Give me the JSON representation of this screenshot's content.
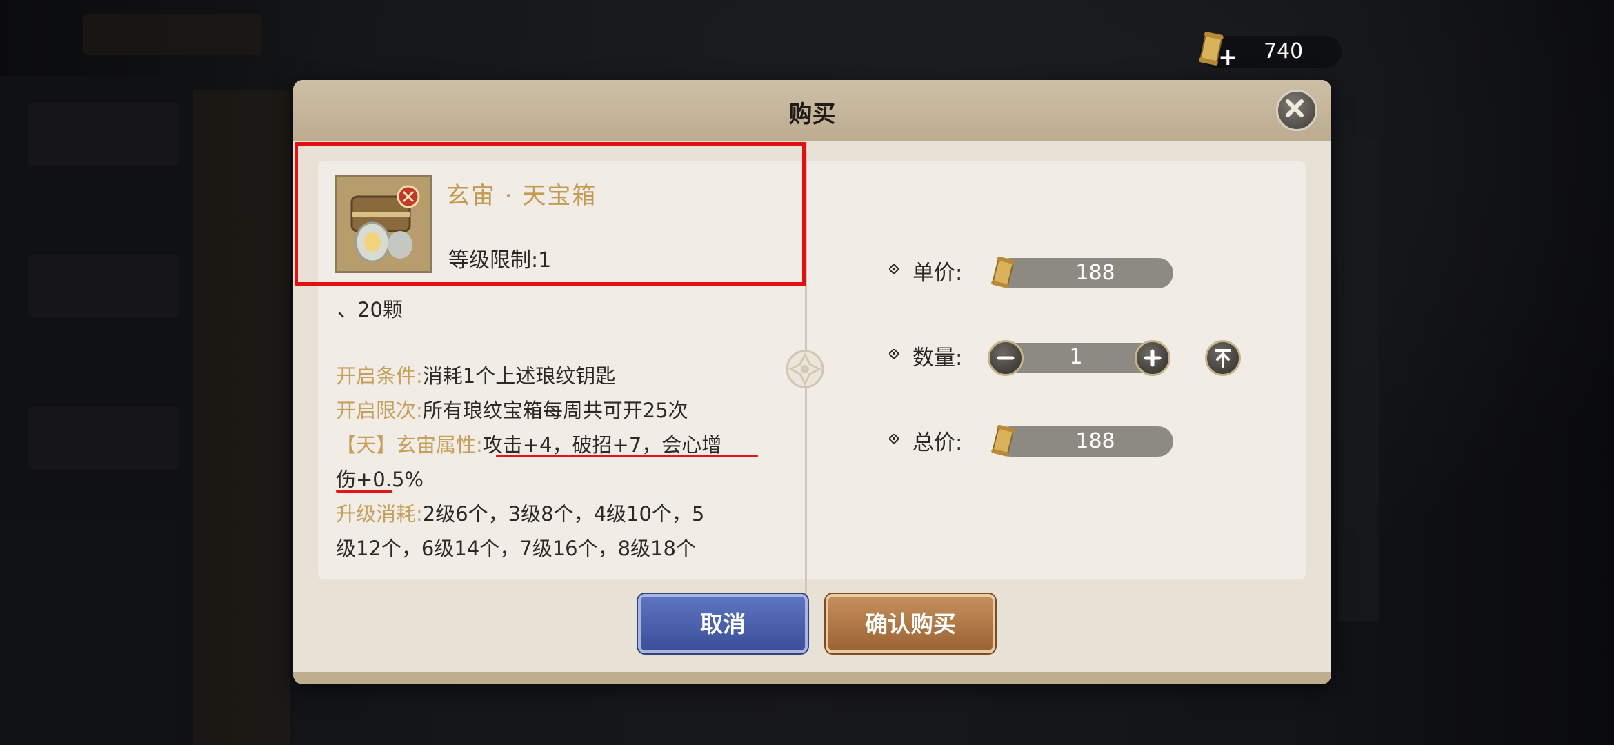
{
  "currency": {
    "value": "740",
    "plus": "+",
    "icon": "scroll-currency-icon"
  },
  "dialog": {
    "title": "购买",
    "close_icon": "close-icon",
    "item": {
      "name": "玄宙 · 天宝箱",
      "level_limit": "等级限制:1",
      "icon": "treasure-chest-icon"
    },
    "description": {
      "line0": "、20颗",
      "open_condition_key": "开启条件:",
      "open_condition_val": "消耗1个上述琅纹钥匙",
      "open_limit_key": "开启限次:",
      "open_limit_val": "所有琅纹宝箱每周共可开25次",
      "attr_key": "【天】玄宙属性:",
      "attr_val_1": "攻击+4，破招+7，会心增",
      "attr_val_2": "伤+0.5%",
      "upgrade_key": "升级消耗:",
      "upgrade_val_1": "2级6个，3级8个，4级10个，5",
      "upgrade_val_2": "级12个，6级14个，7级16个，8级18个"
    },
    "unit_price": {
      "label": "单价:",
      "value": "188"
    },
    "quantity": {
      "label": "数量:",
      "value": "1",
      "minus": "−",
      "plus": "+"
    },
    "total_price": {
      "label": "总价:",
      "value": "188"
    },
    "buttons": {
      "cancel": "取消",
      "confirm": "确认购买"
    }
  },
  "colors": {
    "highlight": "#e50f12",
    "accent_gold": "#c69f5a",
    "cancel_blue": "#4a5fab",
    "confirm_brown": "#b07a48"
  }
}
